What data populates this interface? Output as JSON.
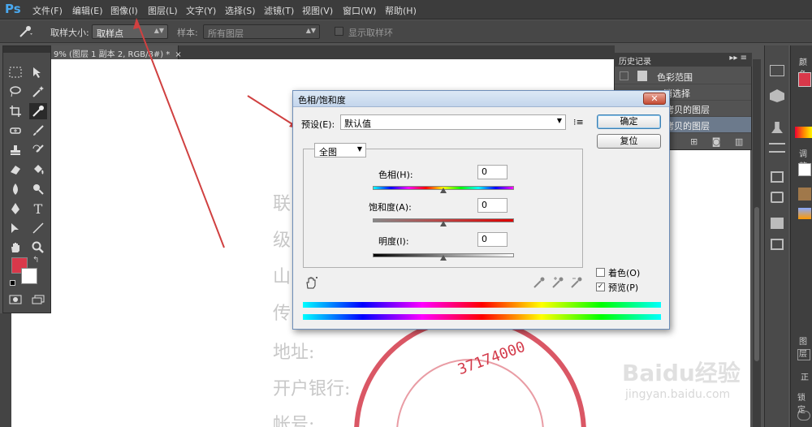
{
  "menubar": {
    "logo": "Ps",
    "items": [
      "文件(F)",
      "编辑(E)",
      "图像(I)",
      "图层(L)",
      "文字(Y)",
      "选择(S)",
      "滤镜(T)",
      "视图(V)",
      "窗口(W)",
      "帮助(H)"
    ]
  },
  "options": {
    "sample_size_label": "取样大小:",
    "sample_size_value": "取样点",
    "sample_label": "样本:",
    "sample_value": "所有图层",
    "show_ring_label": "显示取样环"
  },
  "document": {
    "tab_title": "9% (图层 1 副本 2, RGB/8#) *",
    "background_text": [
      "联",
      "级",
      "山",
      "传",
      "地址:",
      "开户银行:",
      "帐号:"
    ],
    "stamp_number": "37174000"
  },
  "history": {
    "title": "历史记录",
    "items": [
      "色彩范围",
      "消选择",
      "拷贝的图层",
      "拷贝的图层"
    ]
  },
  "right_panels": {
    "swatch_label": "颜色",
    "adjust_label": "调整",
    "layers_label": "图层",
    "normal_label": "正",
    "lock_label": "锁定"
  },
  "dialog": {
    "title": "色相/饱和度",
    "preset_label": "预设(E):",
    "preset_value": "默认值",
    "ok_button": "确定",
    "reset_button": "复位",
    "channel_value": "全图",
    "hue_label": "色相(H):",
    "hue_value": "0",
    "saturation_label": "饱和度(A):",
    "saturation_value": "0",
    "lightness_label": "明度(I):",
    "lightness_value": "0",
    "colorize_label": "着色(O)",
    "colorize_checked": false,
    "preview_label": "预览(P)",
    "preview_checked": true
  },
  "watermark": {
    "logo": "Baidu经验",
    "url": "jingyan.baidu.com"
  },
  "colors": {
    "foreground": "#d9384a",
    "background": "#ffffff",
    "stamp_red": "#d33a4a",
    "annotation_red": "#d04040"
  }
}
